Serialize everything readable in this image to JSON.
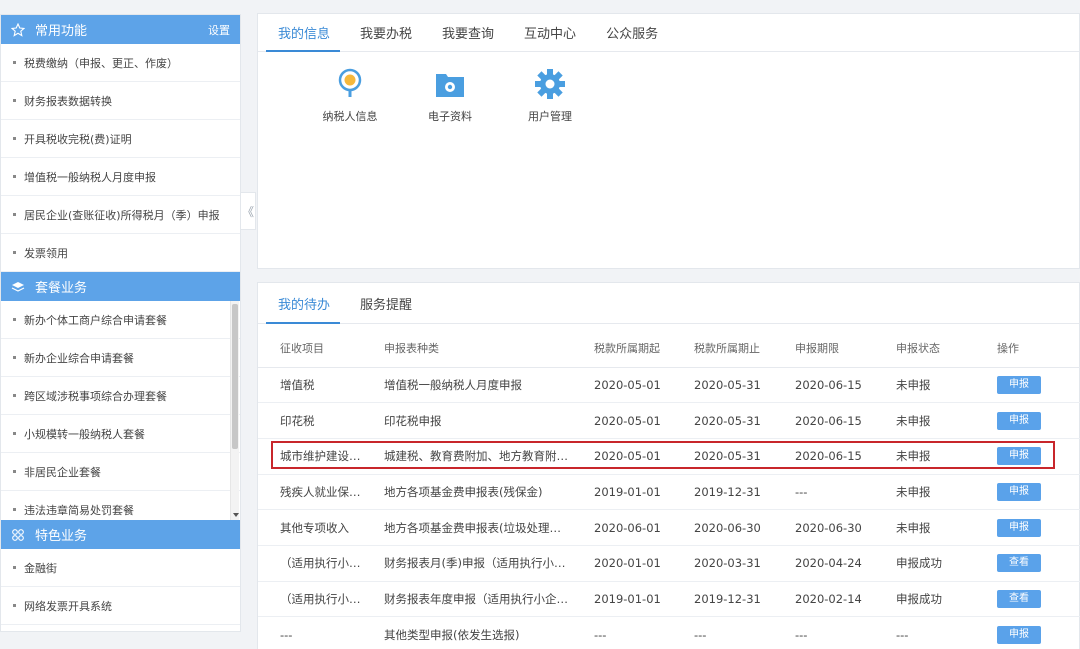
{
  "sidebar": {
    "common": {
      "title": "常用功能",
      "extra": "设置",
      "items": [
        "税费缴纳（申报、更正、作废）",
        "财务报表数据转换",
        "开具税收完税(费)证明",
        "增值税一般纳税人月度申报",
        "居民企业(查账征收)所得税月（季）申报",
        "发票领用"
      ]
    },
    "packages": {
      "title": "套餐业务",
      "items": [
        "新办个体工商户综合申请套餐",
        "新办企业综合申请套餐",
        "跨区域涉税事项综合办理套餐",
        "小规模转一般纳税人套餐",
        "非居民企业套餐",
        "违法违章简易处罚套餐"
      ]
    },
    "special": {
      "title": "特色业务",
      "items": [
        "金融街",
        "网络发票开具系统"
      ]
    },
    "collapse": "《"
  },
  "info": {
    "tabs": [
      "我的信息",
      "我要办税",
      "我要查询",
      "互动中心",
      "公众服务"
    ],
    "icons": [
      {
        "label": "纳税人信息",
        "icon": "taxpayer-info-icon"
      },
      {
        "label": "电子资料",
        "icon": "e-document-icon"
      },
      {
        "label": "用户管理",
        "icon": "gear-icon"
      }
    ]
  },
  "todo": {
    "tabs": [
      "我的待办",
      "服务提醒"
    ],
    "headers": [
      "征收项目",
      "申报表种类",
      "税款所属期起",
      "税款所属期止",
      "申报期限",
      "申报状态",
      "操作"
    ],
    "rows": [
      [
        "增值税",
        "增值税一般纳税人月度申报",
        "2020-05-01",
        "2020-05-31",
        "2020-06-15",
        "未申报",
        "申报"
      ],
      [
        "印花税",
        "印花税申报",
        "2020-05-01",
        "2020-05-31",
        "2020-06-15",
        "未申报",
        "申报"
      ],
      [
        "城市维护建设税、…",
        "城建税、教育费附加、地方教育附加税（…",
        "2020-05-01",
        "2020-05-31",
        "2020-06-15",
        "未申报",
        "申报"
      ],
      [
        "残疾人就业保障金",
        "地方各项基金费申报表(残保金)",
        "2019-01-01",
        "2019-12-31",
        "---",
        "未申报",
        "申报"
      ],
      [
        "其他专项收入",
        "地方各项基金费申报表(垃圾处理费)申报表",
        "2020-06-01",
        "2020-06-30",
        "2020-06-30",
        "未申报",
        "申报"
      ],
      [
        "（适用执行小企业…",
        "财务报表月(季)申报（适用执行小企业会…",
        "2020-01-01",
        "2020-03-31",
        "2020-04-24",
        "申报成功",
        "查看"
      ],
      [
        "（适用执行小企业…",
        "财务报表年度申报（适用执行小企业会计…",
        "2019-01-01",
        "2019-12-31",
        "2020-02-14",
        "申报成功",
        "查看"
      ],
      [
        "---",
        "其他类型申报(依发生选报)",
        "---",
        "---",
        "---",
        "---",
        "申报"
      ]
    ]
  }
}
